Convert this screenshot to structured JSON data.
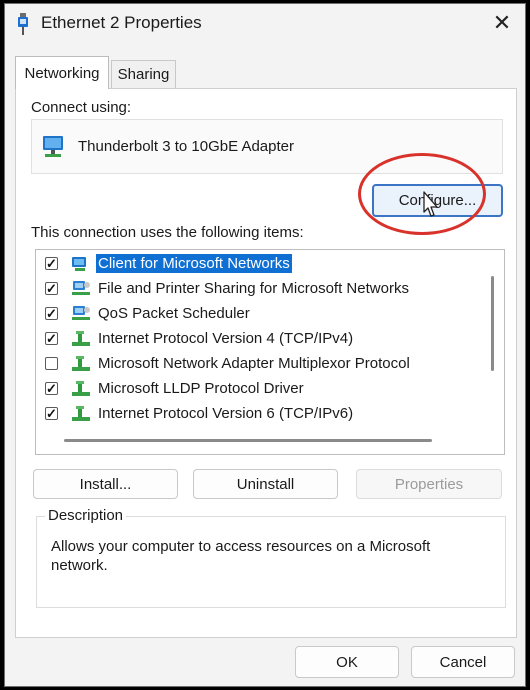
{
  "window": {
    "title": "Ethernet 2 Properties",
    "close_glyph": "✕"
  },
  "tabs": [
    {
      "label": "Networking",
      "active": true
    },
    {
      "label": "Sharing",
      "active": false
    }
  ],
  "connect_using": {
    "label": "Connect using:",
    "adapter_name": "Thunderbolt 3 to 10GbE Adapter",
    "adapter_icon": "network-adapter-icon"
  },
  "configure_button": "Configure...",
  "items_section": {
    "label": "This connection uses the following items:",
    "items": [
      {
        "label": "Client for Microsoft Networks",
        "checked": true,
        "selected": true,
        "icon": "network-client-icon"
      },
      {
        "label": "File and Printer Sharing for Microsoft Networks",
        "checked": true,
        "selected": false,
        "icon": "network-service-icon"
      },
      {
        "label": "QoS Packet Scheduler",
        "checked": true,
        "selected": false,
        "icon": "network-service-icon"
      },
      {
        "label": "Internet Protocol Version 4 (TCP/IPv4)",
        "checked": true,
        "selected": false,
        "icon": "protocol-icon"
      },
      {
        "label": "Microsoft Network Adapter Multiplexor Protocol",
        "checked": false,
        "selected": false,
        "icon": "protocol-icon"
      },
      {
        "label": "Microsoft LLDP Protocol Driver",
        "checked": true,
        "selected": false,
        "icon": "protocol-icon"
      },
      {
        "label": "Internet Protocol Version 6 (TCP/IPv6)",
        "checked": true,
        "selected": false,
        "icon": "protocol-icon"
      }
    ]
  },
  "item_buttons": {
    "install": "Install...",
    "uninstall": "Uninstall",
    "properties": "Properties"
  },
  "description": {
    "legend": "Description",
    "text": "Allows your computer to access resources on a Microsoft network."
  },
  "footer_buttons": {
    "ok": "OK",
    "cancel": "Cancel"
  },
  "colors": {
    "selection": "#0f6fd3",
    "annotation_circle": "#d9322b",
    "focus_border": "#3c74c6"
  }
}
